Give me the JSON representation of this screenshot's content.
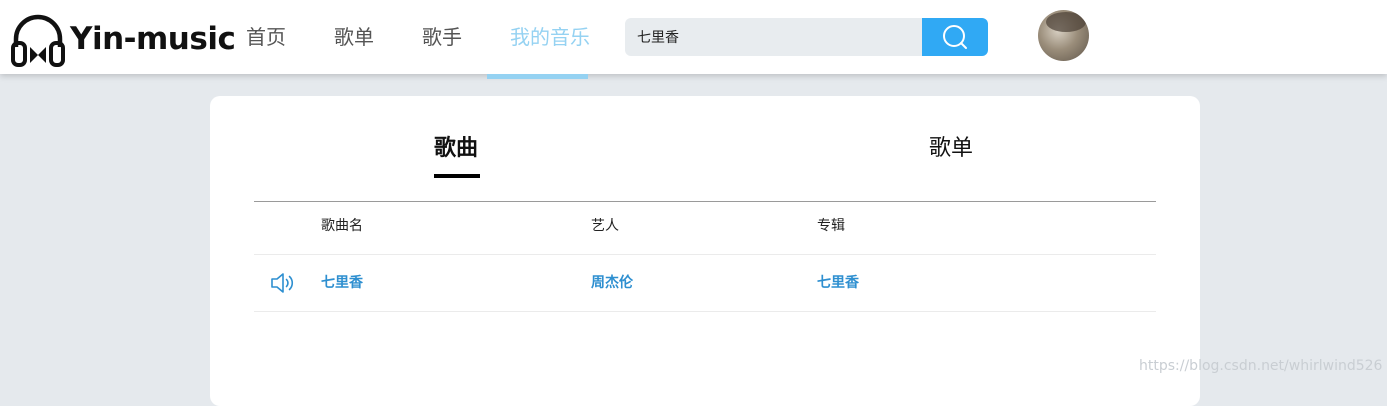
{
  "brand": {
    "name": "Yin-music"
  },
  "nav": {
    "items": [
      {
        "label": "首页"
      },
      {
        "label": "歌单"
      },
      {
        "label": "歌手"
      },
      {
        "label": "我的音乐"
      }
    ],
    "active_index": 3
  },
  "search": {
    "value": "七里香"
  },
  "colors": {
    "accent": "#30a9f4",
    "nav_active": "#95d2f2",
    "link": "#2e8fd0"
  },
  "tabs": [
    {
      "label": "歌曲"
    },
    {
      "label": "歌单"
    }
  ],
  "table": {
    "headers": {
      "name": "歌曲名",
      "artist": "艺人",
      "album": "专辑"
    },
    "rows": [
      {
        "icon": "speaker-icon",
        "name": "七里香",
        "artist": "周杰伦",
        "album": "七里香"
      }
    ]
  },
  "watermark": "https://blog.csdn.net/whirlwind526"
}
